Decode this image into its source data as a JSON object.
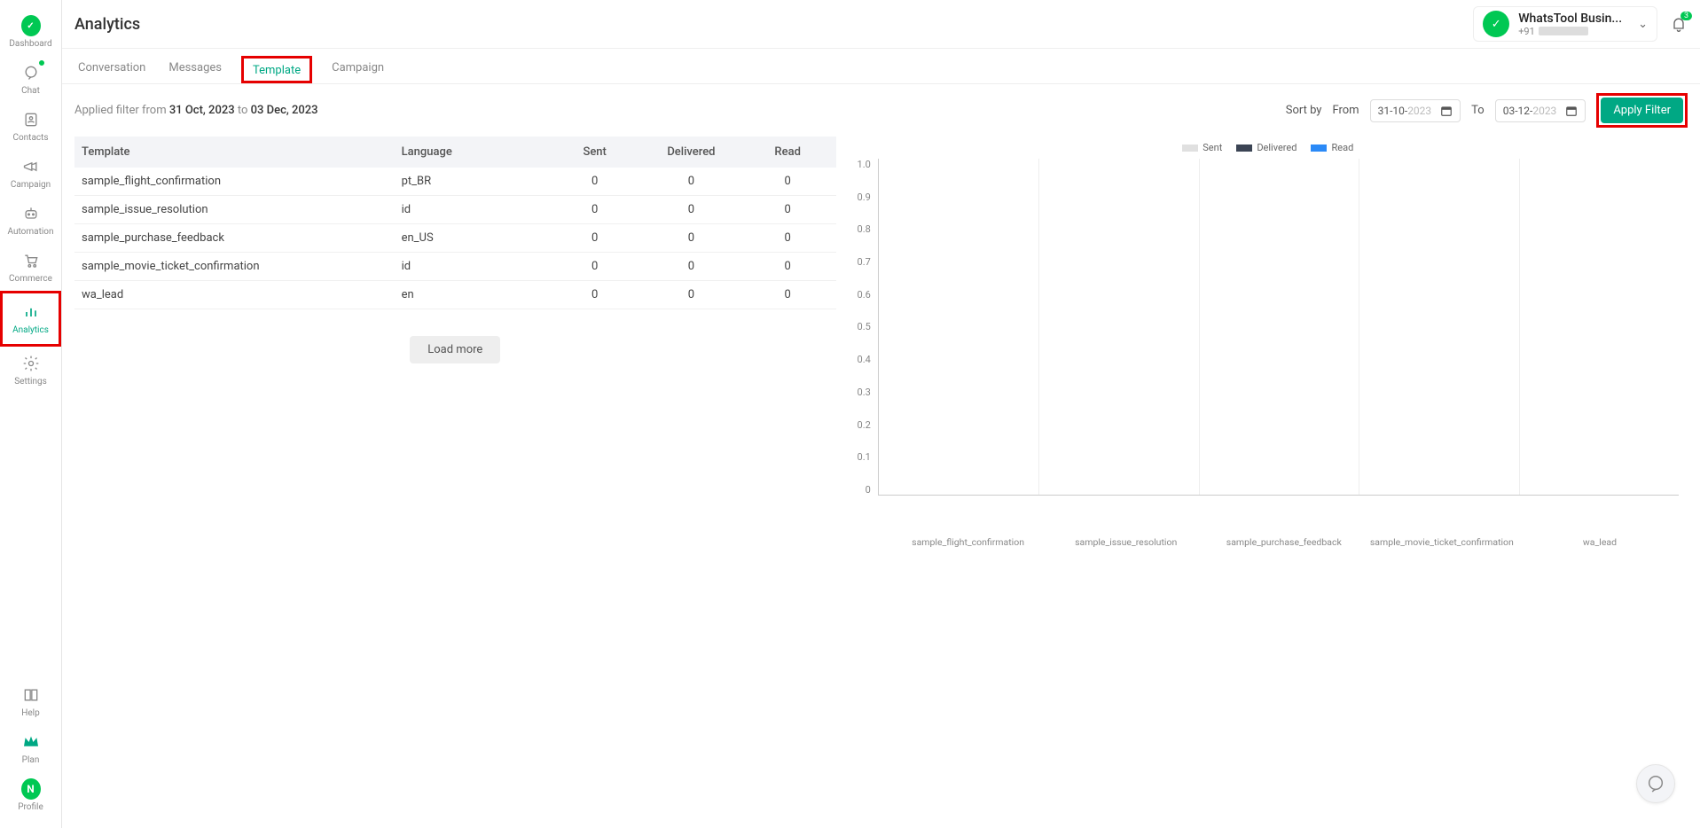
{
  "sidebar": {
    "items": [
      {
        "label": "Dashboard"
      },
      {
        "label": "Chat"
      },
      {
        "label": "Contacts"
      },
      {
        "label": "Campaign"
      },
      {
        "label": "Automation"
      },
      {
        "label": "Commerce"
      },
      {
        "label": "Analytics"
      },
      {
        "label": "Settings"
      }
    ],
    "bottom": [
      {
        "label": "Help"
      },
      {
        "label": "Plan"
      },
      {
        "label": "Profile"
      }
    ],
    "avatar_letter": "N"
  },
  "header": {
    "title": "Analytics",
    "account_name": "WhatsTool Busin...",
    "phone_prefix": "+91",
    "notif_count": "3"
  },
  "tabs": [
    {
      "label": "Conversation"
    },
    {
      "label": "Messages"
    },
    {
      "label": "Template"
    },
    {
      "label": "Campaign"
    }
  ],
  "filter": {
    "applied_prefix": "Applied filter from ",
    "applied_from": "31 Oct, 2023",
    "applied_mid": " to ",
    "applied_to": "03 Dec, 2023",
    "sort_by": "Sort by",
    "from_label": "From",
    "from_val_dm": "31-10-",
    "from_val_y": "2023",
    "to_label": "To",
    "to_val_dm": "03-12-",
    "to_val_y": "2023",
    "apply": "Apply Filter"
  },
  "table": {
    "headers": {
      "template": "Template",
      "language": "Language",
      "sent": "Sent",
      "delivered": "Delivered",
      "read": "Read"
    },
    "rows": [
      {
        "template": "sample_flight_confirmation",
        "language": "pt_BR",
        "sent": "0",
        "delivered": "0",
        "read": "0"
      },
      {
        "template": "sample_issue_resolution",
        "language": "id",
        "sent": "0",
        "delivered": "0",
        "read": "0"
      },
      {
        "template": "sample_purchase_feedback",
        "language": "en_US",
        "sent": "0",
        "delivered": "0",
        "read": "0"
      },
      {
        "template": "sample_movie_ticket_confirmation",
        "language": "id",
        "sent": "0",
        "delivered": "0",
        "read": "0"
      },
      {
        "template": "wa_lead",
        "language": "en",
        "sent": "0",
        "delivered": "0",
        "read": "0"
      }
    ],
    "load_more": "Load more"
  },
  "chart_data": {
    "type": "bar",
    "title": "",
    "legend": [
      "Sent",
      "Delivered",
      "Read"
    ],
    "categories": [
      "sample_flight_confirmation",
      "sample_issue_resolution",
      "sample_purchase_feedback",
      "sample_movie_ticket_confirmation",
      "wa_lead"
    ],
    "series": [
      {
        "name": "Sent",
        "values": [
          0,
          0,
          0,
          0,
          0
        ]
      },
      {
        "name": "Delivered",
        "values": [
          0,
          0,
          0,
          0,
          0
        ]
      },
      {
        "name": "Read",
        "values": [
          0,
          0,
          0,
          0,
          0
        ]
      }
    ],
    "y_ticks": [
      "1.0",
      "0.9",
      "0.8",
      "0.7",
      "0.6",
      "0.5",
      "0.4",
      "0.3",
      "0.2",
      "0.1",
      "0"
    ],
    "ylim": [
      0,
      1.0
    ]
  }
}
